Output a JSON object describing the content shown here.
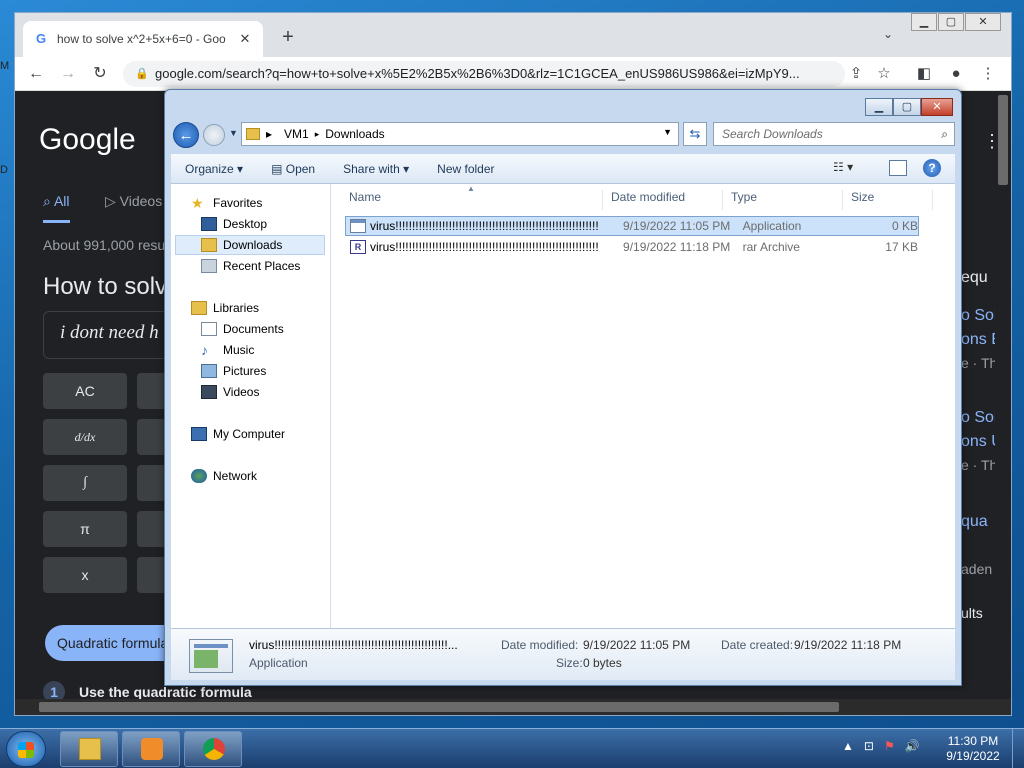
{
  "desktop": {
    "edge_letter_1": "M",
    "edge_letter_2": "D"
  },
  "browser": {
    "tab_title": "how to solve x^2+5x+6=0 - Goo",
    "tab_favicon": "G",
    "url": "google.com/search?q=how+to+solve+x%5E2%2B5x%2B6%3D0&rlz=1C1GCEA_enUS986US986&ei=izMpY9...",
    "page": {
      "logo": "Google",
      "tabs": [
        "All",
        "Videos"
      ],
      "results_count": "About 991,000 resu",
      "heading": "How to solv",
      "calc_display": "i dont need h",
      "calc_keys": [
        "AC",
        "d/dx",
        "∫",
        "π",
        "x"
      ],
      "chip": "Quadratic formula",
      "step_number": "1",
      "step_text": "Use the quadratic formula",
      "right_fragments": [
        "equ",
        "o Sol",
        "ons E",
        "e · Th",
        "o Sol",
        "ons U",
        "e · Th",
        "qua",
        "aden",
        "ults"
      ]
    }
  },
  "explorer": {
    "path": [
      "VM1",
      "Downloads"
    ],
    "search_placeholder": "Search Downloads",
    "commands": [
      "Organize",
      "Open",
      "Share with",
      "New folder"
    ],
    "nav": {
      "favorites": "Favorites",
      "favorites_items": [
        "Desktop",
        "Downloads",
        "Recent Places"
      ],
      "libraries": "Libraries",
      "libraries_items": [
        "Documents",
        "Music",
        "Pictures",
        "Videos"
      ],
      "computer": "My Computer",
      "network": "Network"
    },
    "columns": [
      "Name",
      "Date modified",
      "Type",
      "Size"
    ],
    "files": [
      {
        "name": "virus!!!!!!!!!!!!!!!!!!!!!!!!!!!!!!!!!!!!!!!!!!!!!!!!!!!!!!!!!!!!!",
        "date": "9/19/2022 11:05 PM",
        "type": "Application",
        "size": "0 KB"
      },
      {
        "name": "virus!!!!!!!!!!!!!!!!!!!!!!!!!!!!!!!!!!!!!!!!!!!!!!!!!!!!!!!!!!!!!",
        "date": "9/19/2022 11:18 PM",
        "type": "rar Archive",
        "size": "17 KB"
      }
    ],
    "details": {
      "name": "virus!!!!!!!!!!!!!!!!!!!!!!!!!!!!!!!!!!!!!!!!!!!!!!!!!!!!...",
      "kind": "Application",
      "modified_label": "Date modified:",
      "modified": "9/19/2022 11:05 PM",
      "created_label": "Date created:",
      "created": "9/19/2022 11:18 PM",
      "size_label": "Size:",
      "size": "0 bytes"
    }
  },
  "taskbar": {
    "time": "11:30 PM",
    "date": "9/19/2022"
  }
}
